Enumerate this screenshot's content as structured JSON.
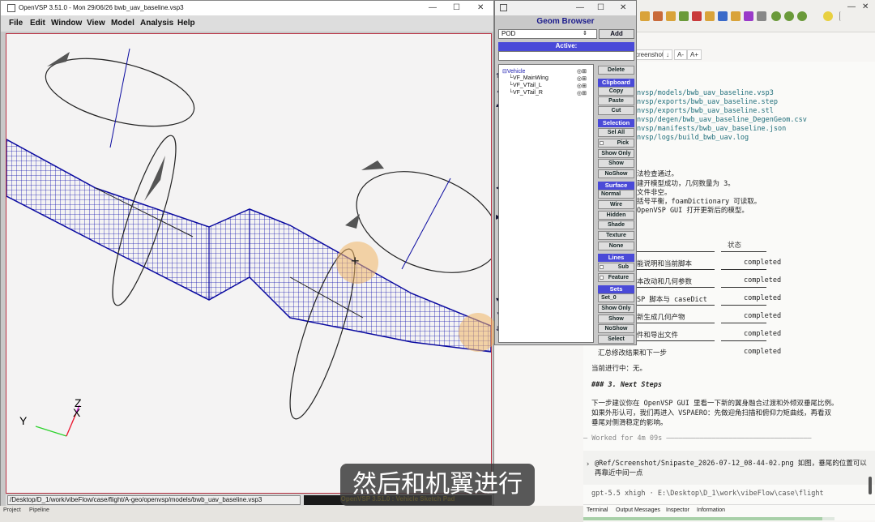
{
  "openvsp": {
    "title": "OpenVSP 3.51.0 - Mon 29/06/26    bwb_uav_baseline.vsp3",
    "menu": [
      "File",
      "Edit",
      "Window",
      "View",
      "Model",
      "Analysis",
      "Help"
    ],
    "status_path": "/Desktop/D_1/work/vibeFlow/case/flight/A-geo/openvsp/models/bwb_uav_baseline.vsp3",
    "status_right": "OpenVSP 3.51.0 : Vehicle Sketch Pad",
    "axes": {
      "y": "Y",
      "z": "Z",
      "x": "X"
    }
  },
  "geom_browser": {
    "title": "Geom Browser",
    "type_value": "POD",
    "add_label": "Add",
    "active_label": "Active:",
    "tree": [
      {
        "label": "Vehicle"
      },
      {
        "label": "VF_MainWing"
      },
      {
        "label": "VF_VTail_L"
      },
      {
        "label": "VF_VTail_R"
      }
    ],
    "buttons": {
      "delete": "Delete",
      "clipboard": "Clipboard",
      "copy": "Copy",
      "paste": "Paste",
      "cut": "Cut",
      "selection": "Selection",
      "sel_all": "Sel All",
      "pick": "Pick",
      "show_only": "Show Only",
      "show": "Show",
      "noshow": "NoShow",
      "surface": "Surface",
      "normal": "Normal",
      "wire": "Wire",
      "hidden": "Hidden",
      "shade": "Shade",
      "texture": "Texture",
      "none": "None",
      "lines": "Lines",
      "sub": "Sub",
      "feature": "Feature",
      "sets": "Sets",
      "set0": "Set_0",
      "show_only2": "Show Only",
      "show2": "Show",
      "noshow2": "NoShow",
      "select": "Select"
    }
  },
  "terminal": {
    "subtoolbar": [
      "creenshot",
      "↓",
      "A-",
      "A+"
    ],
    "paths": [
      "nvsp/models/bwb_uav_baseline.vsp3",
      "nvsp/exports/bwb_uav_baseline.step",
      "nvsp/exports/bwb_uav_baseline.stl",
      "nvsp/degen/bwb_uav_baseline_DegenGeom.csv",
      "nvsp/manifests/bwb_uav_baseline.json",
      "nvsp/logs/build_bwb_uav.log"
    ],
    "lines": [
      "法检查通过。",
      "建开模型成功，几何数量为 3。",
      "文件非空。",
      "括号平衡，foamDictionary 可读取。",
      "OpenVSP GUI 打开更新后的模型。"
    ],
    "status_header": "状态",
    "tasks": [
      {
        "name": "能说明和当前脚本",
        "status": "completed"
      },
      {
        "name": "本改动和几何参数",
        "status": "completed"
      },
      {
        "name": "SP 脚本与 caseDict",
        "status": "completed"
      },
      {
        "name": "新生成几何产物",
        "status": "completed"
      },
      {
        "name": "件和导出文件",
        "status": "completed"
      },
      {
        "name": "汇总修改结果和下一步",
        "status": "completed"
      }
    ],
    "current": "当前进行中：无。",
    "next_heading": "### 3. Next Steps",
    "next_body": [
      "下一步建议你在 OpenVSP GUI 里看一下新的翼身融合过渡和外倾双垂尾比例。",
      "如果外形认可，我们再进入 VSPAERO：先做迎角扫描和俯仰力矩曲线，再看双",
      "垂尾对侧滑稳定的影响。"
    ],
    "worked": "— Worked for 4m 09s ———————————————————————————————————",
    "message": "@Ref/Screenshot/Snipaste_2026-07-12_08-44-02.png 如图，垂尾的位置可以再靠近中间一点",
    "footer": "gpt-5.5 xhigh · E:\\Desktop\\D_1\\work\\vibeFlow\\case\\flight",
    "tabs": [
      "Terminal",
      "Output Messages",
      "Inspector",
      "Information"
    ]
  },
  "bottom_tabs": [
    "Project",
    "Pipeline"
  ],
  "subtitle": "然后和机翼进行"
}
